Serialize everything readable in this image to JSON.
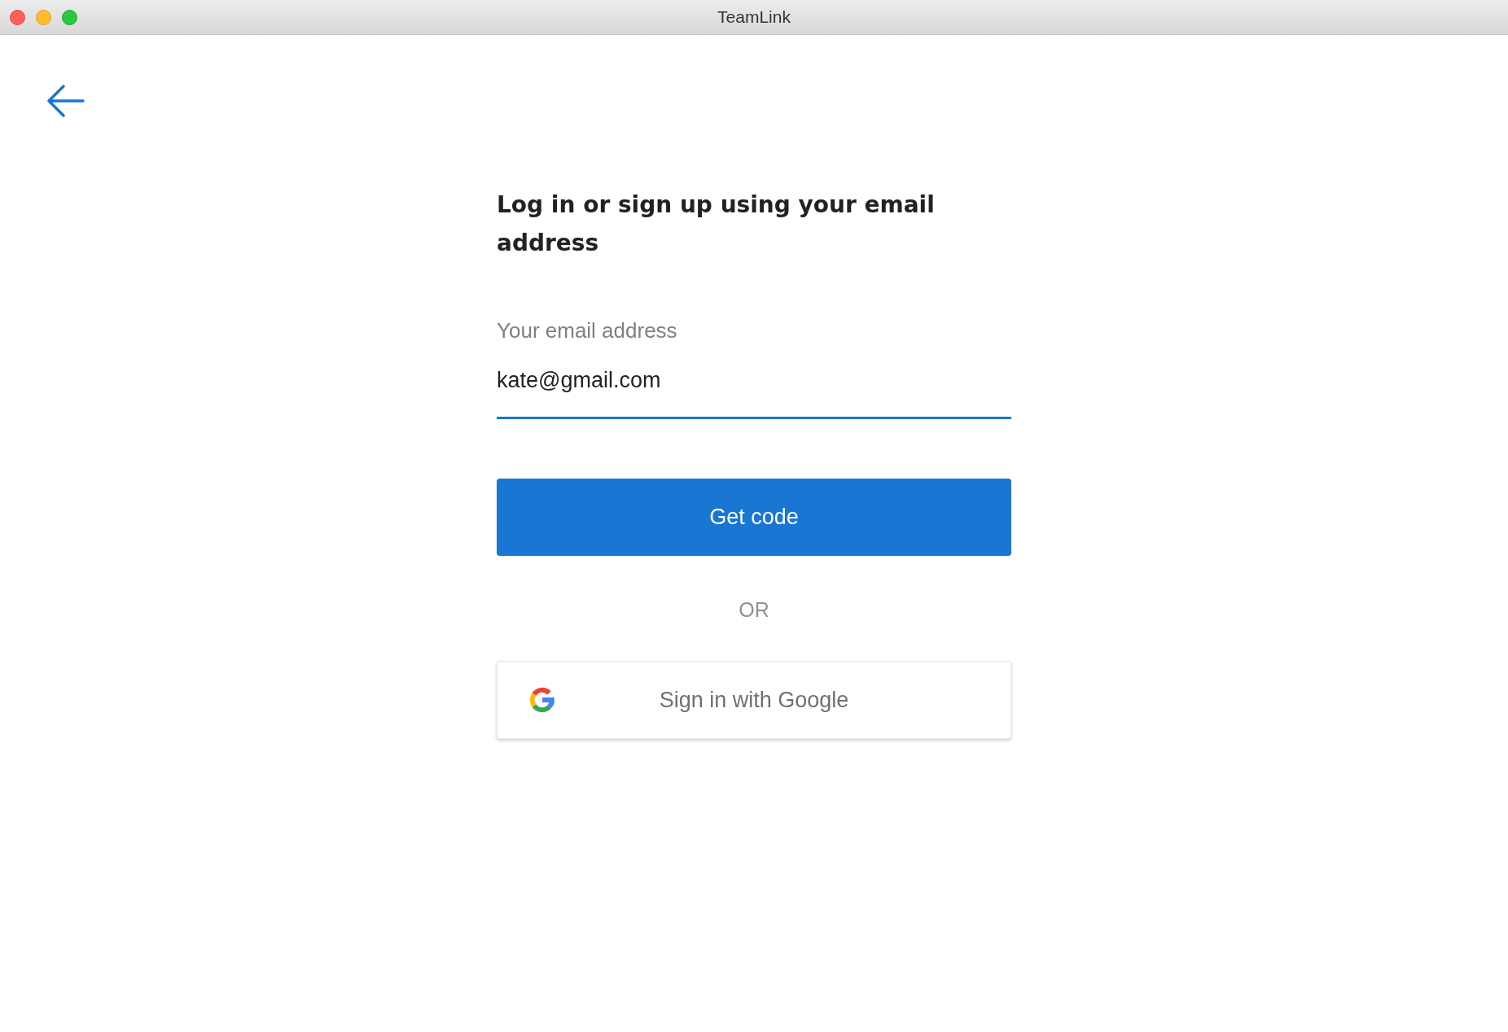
{
  "window": {
    "title": "TeamLink"
  },
  "heading": "Log in or sign up using your email address",
  "email_field": {
    "label": "Your email address",
    "value": "kate@gmail.com",
    "focused": true
  },
  "primary_button": {
    "label": "Get code"
  },
  "separator": "OR",
  "google_button": {
    "label": "Sign in with Google"
  }
}
